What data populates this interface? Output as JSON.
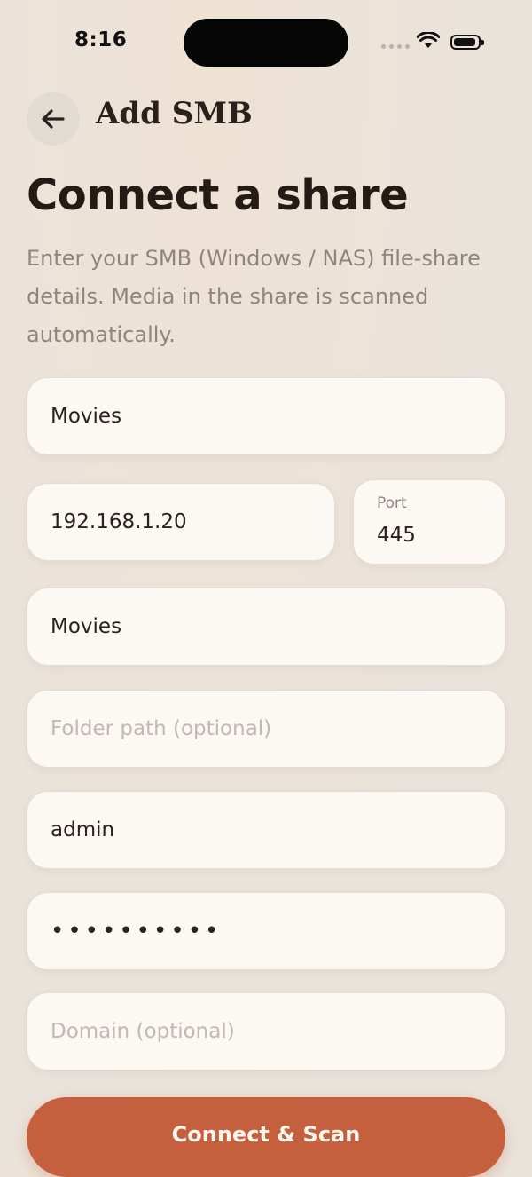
{
  "status_bar": {
    "time": "8:16"
  },
  "header": {
    "title": "Add SMB"
  },
  "main": {
    "heading": "Connect a share",
    "description": "Enter your SMB (Windows / NAS) file-share details. Media in the share is scanned automatically."
  },
  "form": {
    "name": {
      "value": "Movies",
      "placeholder": ""
    },
    "host": {
      "value": "192.168.1.20",
      "placeholder": ""
    },
    "port": {
      "label": "Port",
      "value": "445"
    },
    "share": {
      "value": "Movies",
      "placeholder": ""
    },
    "folder": {
      "value": "",
      "placeholder": "Folder path (optional)"
    },
    "username": {
      "value": "admin",
      "placeholder": ""
    },
    "password": {
      "value": "••••••••••",
      "placeholder": ""
    },
    "domain": {
      "value": "",
      "placeholder": "Domain (optional)"
    }
  },
  "actions": {
    "connect_label": "Connect & Scan"
  },
  "colors": {
    "accent": "#c4603e",
    "background": "#ebe3da",
    "field": "#fcf8f3"
  }
}
